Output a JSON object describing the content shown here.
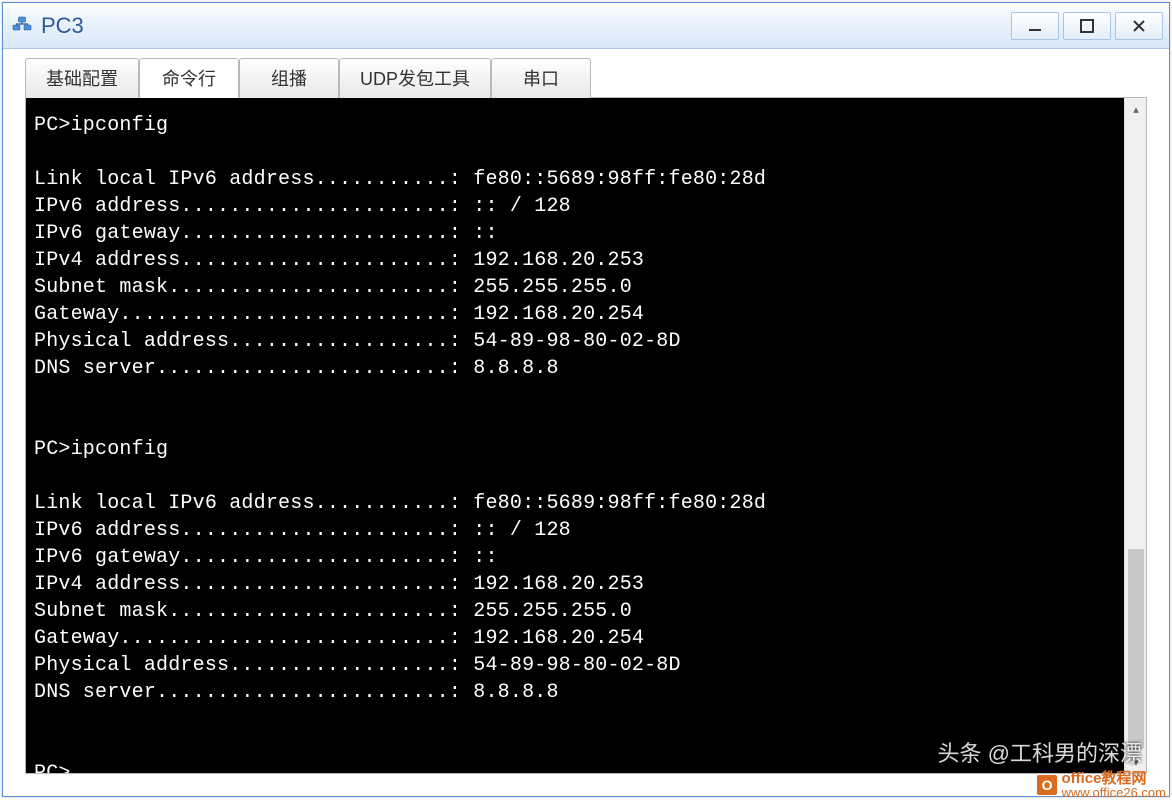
{
  "window": {
    "title": "PC3"
  },
  "tabs": [
    {
      "label": "基础配置"
    },
    {
      "label": "命令行"
    },
    {
      "label": "组播"
    },
    {
      "label": "UDP发包工具"
    },
    {
      "label": "串口"
    }
  ],
  "terminal": {
    "lines": [
      "PC>ipconfig",
      "",
      "Link local IPv6 address...........: fe80::5689:98ff:fe80:28d",
      "IPv6 address......................: :: / 128",
      "IPv6 gateway......................: ::",
      "IPv4 address......................: 192.168.20.253",
      "Subnet mask.......................: 255.255.255.0",
      "Gateway...........................: 192.168.20.254",
      "Physical address..................: 54-89-98-80-02-8D",
      "DNS server........................: 8.8.8.8",
      "",
      "",
      "PC>ipconfig",
      "",
      "Link local IPv6 address...........: fe80::5689:98ff:fe80:28d",
      "IPv6 address......................: :: / 128",
      "IPv6 gateway......................: ::",
      "IPv4 address......................: 192.168.20.253",
      "Subnet mask.......................: 255.255.255.0",
      "Gateway...........................: 192.168.20.254",
      "Physical address..................: 54-89-98-80-02-8D",
      "DNS server........................: 8.8.8.8",
      "",
      "",
      "PC>"
    ]
  },
  "watermark": {
    "text1": "头条 @工科男的深漂",
    "badge": "O",
    "top": "office教程网",
    "bottom": "www.office26.com"
  }
}
